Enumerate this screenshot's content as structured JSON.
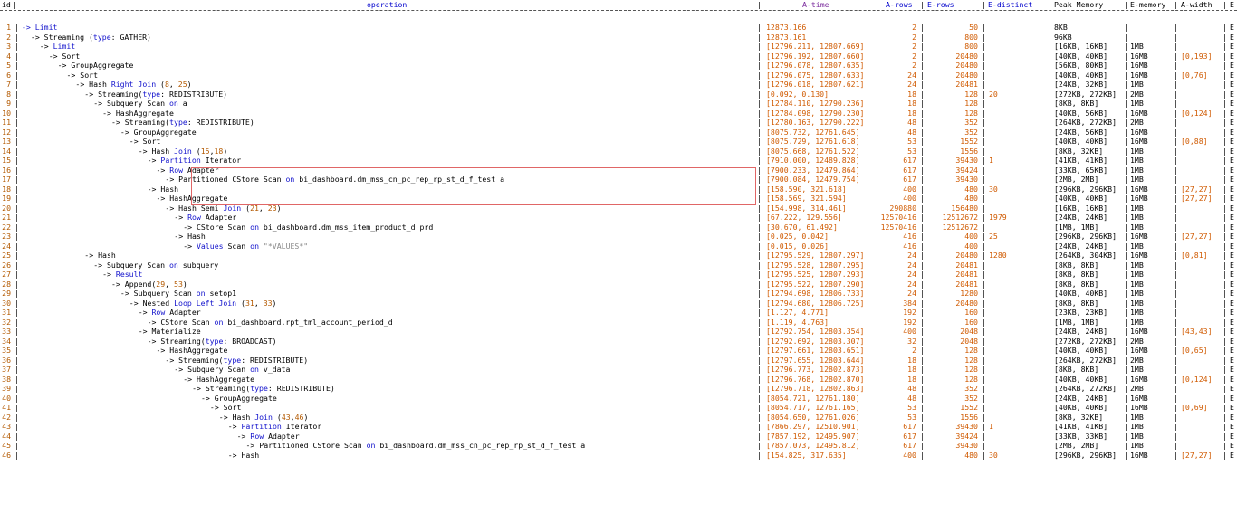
{
  "header": {
    "id": "id",
    "operation": "operation",
    "a_time": "A-time",
    "a_rows": "A-rows",
    "e_rows": "E-rows",
    "e_distinct": "E-distinct",
    "peak_memory": "Peak Memory",
    "e_memory": "E-memory",
    "a_width": "A-width",
    "e_trunc": "E"
  },
  "highlighted_rows": [
    14,
    15,
    16,
    17
  ],
  "colors": {
    "keyword": "#1111cc",
    "number": "#d05a00",
    "highlight_box": "#e06666"
  },
  "rows": [
    {
      "id": "1",
      "indent": 0,
      "op": [
        [
          "kw",
          "-> "
        ],
        [
          "kw",
          "Limit"
        ]
      ],
      "a_time": "12873.166",
      "a_rows": "2",
      "e_rows": "50",
      "e_distinct": "",
      "peak_mem": "8KB",
      "e_mem": "",
      "a_width": ""
    },
    {
      "id": "2",
      "indent": 2,
      "op": [
        [
          "op",
          "-> Streaming ("
        ],
        [
          "kw",
          "type"
        ],
        [
          "op",
          ": GATHER)"
        ]
      ],
      "a_time": "12873.161",
      "a_rows": "2",
      "e_rows": "800",
      "e_distinct": "",
      "peak_mem": "96KB",
      "e_mem": "",
      "a_width": ""
    },
    {
      "id": "3",
      "indent": 4,
      "op": [
        [
          "op",
          "-> "
        ],
        [
          "kw",
          "Limit"
        ]
      ],
      "a_time": "[12796.211, 12807.669]",
      "a_rows": "2",
      "e_rows": "800",
      "e_distinct": "",
      "peak_mem": "[16KB, 16KB]",
      "e_mem": "1MB",
      "a_width": ""
    },
    {
      "id": "4",
      "indent": 6,
      "op": [
        [
          "op",
          "-> Sort"
        ]
      ],
      "a_time": "[12796.192, 12807.660]",
      "a_rows": "2",
      "e_rows": "20480",
      "e_distinct": "",
      "peak_mem": "[40KB, 40KB]",
      "e_mem": "16MB",
      "a_width": "[0,193]"
    },
    {
      "id": "5",
      "indent": 8,
      "op": [
        [
          "op",
          "-> GroupAggregate"
        ]
      ],
      "a_time": "[12796.078, 12807.635]",
      "a_rows": "2",
      "e_rows": "20480",
      "e_distinct": "",
      "peak_mem": "[56KB, 80KB]",
      "e_mem": "16MB",
      "a_width": ""
    },
    {
      "id": "6",
      "indent": 10,
      "op": [
        [
          "op",
          "-> Sort"
        ]
      ],
      "a_time": "[12796.075, 12807.633]",
      "a_rows": "24",
      "e_rows": "20480",
      "e_distinct": "",
      "peak_mem": "[40KB, 40KB]",
      "e_mem": "16MB",
      "a_width": "[0,76]"
    },
    {
      "id": "7",
      "indent": 12,
      "op": [
        [
          "op",
          "-> Hash "
        ],
        [
          "kw",
          "Right Join"
        ],
        [
          "op",
          " ("
        ],
        [
          "num",
          "8"
        ],
        [
          "op",
          ", "
        ],
        [
          "num",
          "25"
        ],
        [
          "op",
          ")"
        ]
      ],
      "a_time": "[12796.018, 12807.621]",
      "a_rows": "24",
      "e_rows": "20481",
      "e_distinct": "",
      "peak_mem": "[24KB, 32KB]",
      "e_mem": "1MB",
      "a_width": ""
    },
    {
      "id": "8",
      "indent": 14,
      "op": [
        [
          "op",
          "-> Streaming("
        ],
        [
          "kw",
          "type"
        ],
        [
          "op",
          ": REDISTRIBUTE)"
        ]
      ],
      "a_time": "[0.092, 0.130]",
      "a_rows": "18",
      "e_rows": "128",
      "e_distinct": "20",
      "peak_mem": "[272KB, 272KB]",
      "e_mem": "2MB",
      "a_width": ""
    },
    {
      "id": "9",
      "indent": 16,
      "op": [
        [
          "op",
          "-> Subquery Scan "
        ],
        [
          "kw",
          "on"
        ],
        [
          "op",
          " a"
        ]
      ],
      "a_time": "[12784.110, 12790.236]",
      "a_rows": "18",
      "e_rows": "128",
      "e_distinct": "",
      "peak_mem": "[8KB, 8KB]",
      "e_mem": "1MB",
      "a_width": ""
    },
    {
      "id": "10",
      "indent": 18,
      "op": [
        [
          "op",
          "-> HashAggregate"
        ]
      ],
      "a_time": "[12784.098, 12790.230]",
      "a_rows": "18",
      "e_rows": "128",
      "e_distinct": "",
      "peak_mem": "[40KB, 56KB]",
      "e_mem": "16MB",
      "a_width": "[0,124]"
    },
    {
      "id": "11",
      "indent": 20,
      "op": [
        [
          "op",
          "-> Streaming("
        ],
        [
          "kw",
          "type"
        ],
        [
          "op",
          ": REDISTRIBUTE)"
        ]
      ],
      "a_time": "[12780.163, 12790.222]",
      "a_rows": "48",
      "e_rows": "352",
      "e_distinct": "",
      "peak_mem": "[264KB, 272KB]",
      "e_mem": "2MB",
      "a_width": ""
    },
    {
      "id": "12",
      "indent": 22,
      "op": [
        [
          "op",
          "-> GroupAggregate"
        ]
      ],
      "a_time": "[8075.732, 12761.645]",
      "a_rows": "48",
      "e_rows": "352",
      "e_distinct": "",
      "peak_mem": "[24KB, 56KB]",
      "e_mem": "16MB",
      "a_width": ""
    },
    {
      "id": "13",
      "indent": 24,
      "op": [
        [
          "op",
          "-> Sort"
        ]
      ],
      "a_time": "[8075.729, 12761.618]",
      "a_rows": "53",
      "e_rows": "1552",
      "e_distinct": "",
      "peak_mem": "[40KB, 40KB]",
      "e_mem": "16MB",
      "a_width": "[0,88]"
    },
    {
      "id": "14",
      "indent": 26,
      "op": [
        [
          "op",
          "-> Hash "
        ],
        [
          "kw",
          "Join"
        ],
        [
          "op",
          " ("
        ],
        [
          "num",
          "15"
        ],
        [
          "op",
          ","
        ],
        [
          "num",
          "18"
        ],
        [
          "op",
          ")"
        ]
      ],
      "a_time": "[8075.668, 12761.522]",
      "a_rows": "53",
      "e_rows": "1556",
      "e_distinct": "",
      "peak_mem": "[8KB, 32KB]",
      "e_mem": "1MB",
      "a_width": ""
    },
    {
      "id": "15",
      "indent": 28,
      "op": [
        [
          "op",
          "-> "
        ],
        [
          "kw",
          "Partition"
        ],
        [
          "op",
          " Iterator"
        ]
      ],
      "a_time": "[7910.000, 12489.828]",
      "a_rows": "617",
      "e_rows": "39430",
      "e_distinct": "1",
      "peak_mem": "[41KB, 41KB]",
      "e_mem": "1MB",
      "a_width": ""
    },
    {
      "id": "16",
      "indent": 30,
      "op": [
        [
          "op",
          "-> "
        ],
        [
          "kw",
          "Row"
        ],
        [
          "op",
          " Adapter"
        ]
      ],
      "a_time": "[7900.233, 12479.864]",
      "a_rows": "617",
      "e_rows": "39424",
      "e_distinct": "",
      "peak_mem": "[33KB, 65KB]",
      "e_mem": "1MB",
      "a_width": ""
    },
    {
      "id": "17",
      "indent": 32,
      "op": [
        [
          "op",
          "-> Partitioned CStore Scan "
        ],
        [
          "kw",
          "on"
        ],
        [
          "op",
          " bi_dashboard.dm_mss_cn_pc_rep_rp_st_d_f_test a"
        ]
      ],
      "a_time": "[7900.084, 12479.754]",
      "a_rows": "617",
      "e_rows": "39430",
      "e_distinct": "",
      "peak_mem": "[2MB, 2MB]",
      "e_mem": "1MB",
      "a_width": ""
    },
    {
      "id": "18",
      "indent": 28,
      "op": [
        [
          "op",
          "-> Hash"
        ]
      ],
      "a_time": "[158.590, 321.618]",
      "a_rows": "400",
      "e_rows": "480",
      "e_distinct": "30",
      "peak_mem": "[296KB, 296KB]",
      "e_mem": "16MB",
      "a_width": "[27,27]"
    },
    {
      "id": "19",
      "indent": 30,
      "op": [
        [
          "op",
          "-> HashAggregate"
        ]
      ],
      "a_time": "[158.569, 321.594]",
      "a_rows": "400",
      "e_rows": "480",
      "e_distinct": "",
      "peak_mem": "[40KB, 40KB]",
      "e_mem": "16MB",
      "a_width": "[27,27]"
    },
    {
      "id": "20",
      "indent": 32,
      "op": [
        [
          "op",
          "-> Hash Semi "
        ],
        [
          "kw",
          "Join"
        ],
        [
          "op",
          " ("
        ],
        [
          "num",
          "21"
        ],
        [
          "op",
          ", "
        ],
        [
          "num",
          "23"
        ],
        [
          "op",
          ")"
        ]
      ],
      "a_time": "[154.998, 314.461]",
      "a_rows": "290880",
      "e_rows": "156480",
      "e_distinct": "",
      "peak_mem": "[16KB, 16KB]",
      "e_mem": "1MB",
      "a_width": ""
    },
    {
      "id": "21",
      "indent": 34,
      "op": [
        [
          "op",
          "-> "
        ],
        [
          "kw",
          "Row"
        ],
        [
          "op",
          " Adapter"
        ]
      ],
      "a_time": "[67.222, 129.556]",
      "a_rows": "12570416",
      "e_rows": "12512672",
      "e_distinct": "1979",
      "peak_mem": "[24KB, 24KB]",
      "e_mem": "1MB",
      "a_width": ""
    },
    {
      "id": "22",
      "indent": 36,
      "op": [
        [
          "op",
          "-> CStore Scan "
        ],
        [
          "kw",
          "on"
        ],
        [
          "op",
          " bi_dashboard.dm_mss_item_product_d prd"
        ]
      ],
      "a_time": "[30.670, 61.492]",
      "a_rows": "12570416",
      "e_rows": "12512672",
      "e_distinct": "",
      "peak_mem": "[1MB, 1MB]",
      "e_mem": "1MB",
      "a_width": ""
    },
    {
      "id": "23",
      "indent": 34,
      "op": [
        [
          "op",
          "-> Hash"
        ]
      ],
      "a_time": "[0.025, 0.042]",
      "a_rows": "416",
      "e_rows": "400",
      "e_distinct": "25",
      "peak_mem": "[296KB, 296KB]",
      "e_mem": "16MB",
      "a_width": "[27,27]"
    },
    {
      "id": "24",
      "indent": 36,
      "op": [
        [
          "op",
          "-> "
        ],
        [
          "kw",
          "Values"
        ],
        [
          "op",
          " Scan "
        ],
        [
          "kw",
          "on"
        ],
        [
          "str",
          " \"*VALUES*\""
        ]
      ],
      "a_time": "[0.015, 0.026]",
      "a_rows": "416",
      "e_rows": "400",
      "e_distinct": "",
      "peak_mem": "[24KB, 24KB]",
      "e_mem": "1MB",
      "a_width": ""
    },
    {
      "id": "25",
      "indent": 14,
      "op": [
        [
          "op",
          "-> Hash"
        ]
      ],
      "a_time": "[12795.529, 12807.297]",
      "a_rows": "24",
      "e_rows": "20480",
      "e_distinct": "1280",
      "peak_mem": "[264KB, 304KB]",
      "e_mem": "16MB",
      "a_width": "[0,81]"
    },
    {
      "id": "26",
      "indent": 16,
      "op": [
        [
          "op",
          "-> Subquery Scan "
        ],
        [
          "kw",
          "on"
        ],
        [
          "op",
          " subquery"
        ]
      ],
      "a_time": "[12795.528, 12807.295]",
      "a_rows": "24",
      "e_rows": "20481",
      "e_distinct": "",
      "peak_mem": "[8KB, 8KB]",
      "e_mem": "1MB",
      "a_width": ""
    },
    {
      "id": "27",
      "indent": 18,
      "op": [
        [
          "op",
          "-> "
        ],
        [
          "kw",
          "Result"
        ]
      ],
      "a_time": "[12795.525, 12807.293]",
      "a_rows": "24",
      "e_rows": "20481",
      "e_distinct": "",
      "peak_mem": "[8KB, 8KB]",
      "e_mem": "1MB",
      "a_width": ""
    },
    {
      "id": "28",
      "indent": 20,
      "op": [
        [
          "op",
          "-> Append("
        ],
        [
          "num",
          "29"
        ],
        [
          "op",
          ", "
        ],
        [
          "num",
          "53"
        ],
        [
          "op",
          ")"
        ]
      ],
      "a_time": "[12795.522, 12807.290]",
      "a_rows": "24",
      "e_rows": "20481",
      "e_distinct": "",
      "peak_mem": "[8KB, 8KB]",
      "e_mem": "1MB",
      "a_width": ""
    },
    {
      "id": "29",
      "indent": 22,
      "op": [
        [
          "op",
          "-> Subquery Scan "
        ],
        [
          "kw",
          "on"
        ],
        [
          "op",
          " setop1"
        ]
      ],
      "a_time": "[12794.698, 12806.733]",
      "a_rows": "24",
      "e_rows": "1280",
      "e_distinct": "",
      "peak_mem": "[40KB, 40KB]",
      "e_mem": "1MB",
      "a_width": ""
    },
    {
      "id": "30",
      "indent": 24,
      "op": [
        [
          "op",
          "-> Nested "
        ],
        [
          "kw",
          "Loop Left Join"
        ],
        [
          "op",
          " ("
        ],
        [
          "num",
          "31"
        ],
        [
          "op",
          ", "
        ],
        [
          "num",
          "33"
        ],
        [
          "op",
          ")"
        ]
      ],
      "a_time": "[12794.680, 12806.725]",
      "a_rows": "384",
      "e_rows": "20480",
      "e_distinct": "",
      "peak_mem": "[8KB, 8KB]",
      "e_mem": "1MB",
      "a_width": ""
    },
    {
      "id": "31",
      "indent": 26,
      "op": [
        [
          "op",
          "-> "
        ],
        [
          "kw",
          "Row"
        ],
        [
          "op",
          " Adapter"
        ]
      ],
      "a_time": "[1.127, 4.771]",
      "a_rows": "192",
      "e_rows": "160",
      "e_distinct": "",
      "peak_mem": "[23KB, 23KB]",
      "e_mem": "1MB",
      "a_width": ""
    },
    {
      "id": "32",
      "indent": 28,
      "op": [
        [
          "op",
          "-> CStore Scan "
        ],
        [
          "kw",
          "on"
        ],
        [
          "op",
          " bi_dashboard.rpt_tml_account_period_d"
        ]
      ],
      "a_time": "[1.119, 4.763]",
      "a_rows": "192",
      "e_rows": "160",
      "e_distinct": "",
      "peak_mem": "[1MB, 1MB]",
      "e_mem": "1MB",
      "a_width": ""
    },
    {
      "id": "33",
      "indent": 26,
      "op": [
        [
          "op",
          "-> Materialize"
        ]
      ],
      "a_time": "[12792.754, 12803.354]",
      "a_rows": "400",
      "e_rows": "2048",
      "e_distinct": "",
      "peak_mem": "[24KB, 24KB]",
      "e_mem": "16MB",
      "a_width": "[43,43]"
    },
    {
      "id": "34",
      "indent": 28,
      "op": [
        [
          "op",
          "-> Streaming("
        ],
        [
          "kw",
          "type"
        ],
        [
          "op",
          ": BROADCAST)"
        ]
      ],
      "a_time": "[12792.692, 12803.307]",
      "a_rows": "32",
      "e_rows": "2048",
      "e_distinct": "",
      "peak_mem": "[272KB, 272KB]",
      "e_mem": "2MB",
      "a_width": ""
    },
    {
      "id": "35",
      "indent": 30,
      "op": [
        [
          "op",
          "-> HashAggregate"
        ]
      ],
      "a_time": "[12797.661, 12803.651]",
      "a_rows": "2",
      "e_rows": "128",
      "e_distinct": "",
      "peak_mem": "[40KB, 40KB]",
      "e_mem": "16MB",
      "a_width": "[0,65]"
    },
    {
      "id": "36",
      "indent": 32,
      "op": [
        [
          "op",
          "-> Streaming("
        ],
        [
          "kw",
          "type"
        ],
        [
          "op",
          ": REDISTRIBUTE)"
        ]
      ],
      "a_time": "[12797.655, 12803.644]",
      "a_rows": "18",
      "e_rows": "128",
      "e_distinct": "",
      "peak_mem": "[264KB, 272KB]",
      "e_mem": "2MB",
      "a_width": ""
    },
    {
      "id": "37",
      "indent": 34,
      "op": [
        [
          "op",
          "-> Subquery Scan "
        ],
        [
          "kw",
          "on"
        ],
        [
          "op",
          " v_data"
        ]
      ],
      "a_time": "[12796.773, 12802.873]",
      "a_rows": "18",
      "e_rows": "128",
      "e_distinct": "",
      "peak_mem": "[8KB, 8KB]",
      "e_mem": "1MB",
      "a_width": ""
    },
    {
      "id": "38",
      "indent": 36,
      "op": [
        [
          "op",
          "-> HashAggregate"
        ]
      ],
      "a_time": "[12796.768, 12802.870]",
      "a_rows": "18",
      "e_rows": "128",
      "e_distinct": "",
      "peak_mem": "[40KB, 40KB]",
      "e_mem": "16MB",
      "a_width": "[0,124]"
    },
    {
      "id": "39",
      "indent": 38,
      "op": [
        [
          "op",
          "-> Streaming("
        ],
        [
          "kw",
          "type"
        ],
        [
          "op",
          ": REDISTRIBUTE)"
        ]
      ],
      "a_time": "[12796.718, 12802.863]",
      "a_rows": "48",
      "e_rows": "352",
      "e_distinct": "",
      "peak_mem": "[264KB, 272KB]",
      "e_mem": "2MB",
      "a_width": ""
    },
    {
      "id": "40",
      "indent": 40,
      "op": [
        [
          "op",
          "-> GroupAggregate"
        ]
      ],
      "a_time": "[8054.721, 12761.180]",
      "a_rows": "48",
      "e_rows": "352",
      "e_distinct": "",
      "peak_mem": "[24KB, 24KB]",
      "e_mem": "16MB",
      "a_width": ""
    },
    {
      "id": "41",
      "indent": 42,
      "op": [
        [
          "op",
          "-> Sort"
        ]
      ],
      "a_time": "[8054.717, 12761.165]",
      "a_rows": "53",
      "e_rows": "1552",
      "e_distinct": "",
      "peak_mem": "[40KB, 40KB]",
      "e_mem": "16MB",
      "a_width": "[0,69]"
    },
    {
      "id": "42",
      "indent": 44,
      "op": [
        [
          "op",
          "-> Hash "
        ],
        [
          "kw",
          "Join"
        ],
        [
          "op",
          " ("
        ],
        [
          "num",
          "43"
        ],
        [
          "op",
          ","
        ],
        [
          "num",
          "46"
        ],
        [
          "op",
          ")"
        ]
      ],
      "a_time": "[8054.650, 12761.026]",
      "a_rows": "53",
      "e_rows": "1556",
      "e_distinct": "",
      "peak_mem": "[8KB, 32KB]",
      "e_mem": "1MB",
      "a_width": ""
    },
    {
      "id": "43",
      "indent": 46,
      "op": [
        [
          "op",
          "-> "
        ],
        [
          "kw",
          "Partition"
        ],
        [
          "op",
          " Iterator"
        ]
      ],
      "a_time": "[7866.297, 12510.901]",
      "a_rows": "617",
      "e_rows": "39430",
      "e_distinct": "1",
      "peak_mem": "[41KB, 41KB]",
      "e_mem": "1MB",
      "a_width": ""
    },
    {
      "id": "44",
      "indent": 48,
      "op": [
        [
          "op",
          "-> "
        ],
        [
          "kw",
          "Row"
        ],
        [
          "op",
          " Adapter"
        ]
      ],
      "a_time": "[7857.192, 12495.907]",
      "a_rows": "617",
      "e_rows": "39424",
      "e_distinct": "",
      "peak_mem": "[33KB, 33KB]",
      "e_mem": "1MB",
      "a_width": ""
    },
    {
      "id": "45",
      "indent": 50,
      "op": [
        [
          "op",
          "-> Partitioned CStore Scan "
        ],
        [
          "kw",
          "on"
        ],
        [
          "op",
          " bi_dashboard.dm_mss_cn_pc_rep_rp_st_d_f_test a"
        ]
      ],
      "a_time": "[7857.073, 12495.812]",
      "a_rows": "617",
      "e_rows": "39430",
      "e_distinct": "",
      "peak_mem": "[2MB, 2MB]",
      "e_mem": "1MB",
      "a_width": ""
    },
    {
      "id": "46",
      "indent": 46,
      "op": [
        [
          "op",
          "-> Hash"
        ]
      ],
      "a_time": "[154.825, 317.635]",
      "a_rows": "400",
      "e_rows": "480",
      "e_distinct": "30",
      "peak_mem": "[296KB, 296KB]",
      "e_mem": "16MB",
      "a_width": "[27,27]"
    }
  ]
}
